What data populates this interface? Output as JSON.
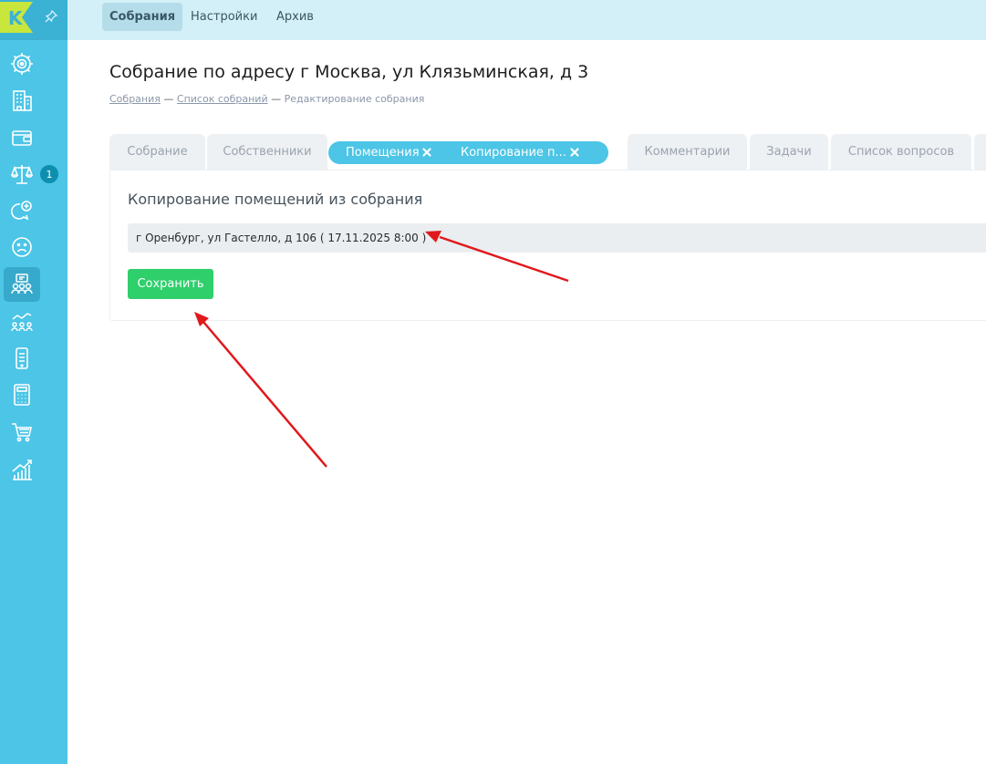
{
  "sidebar": {
    "logo_letter": "K",
    "badge": "1",
    "items": [
      {
        "icon": "gear-dashboard-icon"
      },
      {
        "icon": "building-icon"
      },
      {
        "icon": "wallet-icon"
      },
      {
        "icon": "scales-icon"
      },
      {
        "icon": "chat-plus-icon"
      },
      {
        "icon": "sad-face-icon"
      },
      {
        "icon": "meeting-people-icon"
      },
      {
        "icon": "analytics-people-icon"
      },
      {
        "icon": "mobile-device-icon"
      },
      {
        "icon": "calculator-icon"
      },
      {
        "icon": "cart-icon"
      },
      {
        "icon": "growth-chart-icon"
      }
    ]
  },
  "topnav": {
    "tabs": [
      "Собрания",
      "Настройки",
      "Архив"
    ]
  },
  "page": {
    "title": "Собрание по адресу г Москва, ул Клязьминская, д 3",
    "breadcrumb": {
      "crumb1": "Собрания",
      "sep1": " — ",
      "crumb2": "Список собраний",
      "sep2": " — ",
      "current": "Редактирование собрания"
    }
  },
  "tabs": {
    "meeting": "Собрание",
    "owners": "Собственники",
    "premises": "Помещения",
    "copying": "Копирование п...",
    "comments": "Комментарии",
    "tasks": "Задачи",
    "questions": "Список вопросов"
  },
  "card": {
    "title": "Копирование помещений из собрания",
    "selected_meeting": "г Оренбург, ул Гастелло, д 106 ( 17.11.2025 8:00 )",
    "save_label": "Сохранить"
  },
  "colors": {
    "sidebar": "#4cc5e6",
    "accent": "#4cc5e6",
    "save_button": "#2fcf6c",
    "annotation_arrow": "#e0191c"
  }
}
